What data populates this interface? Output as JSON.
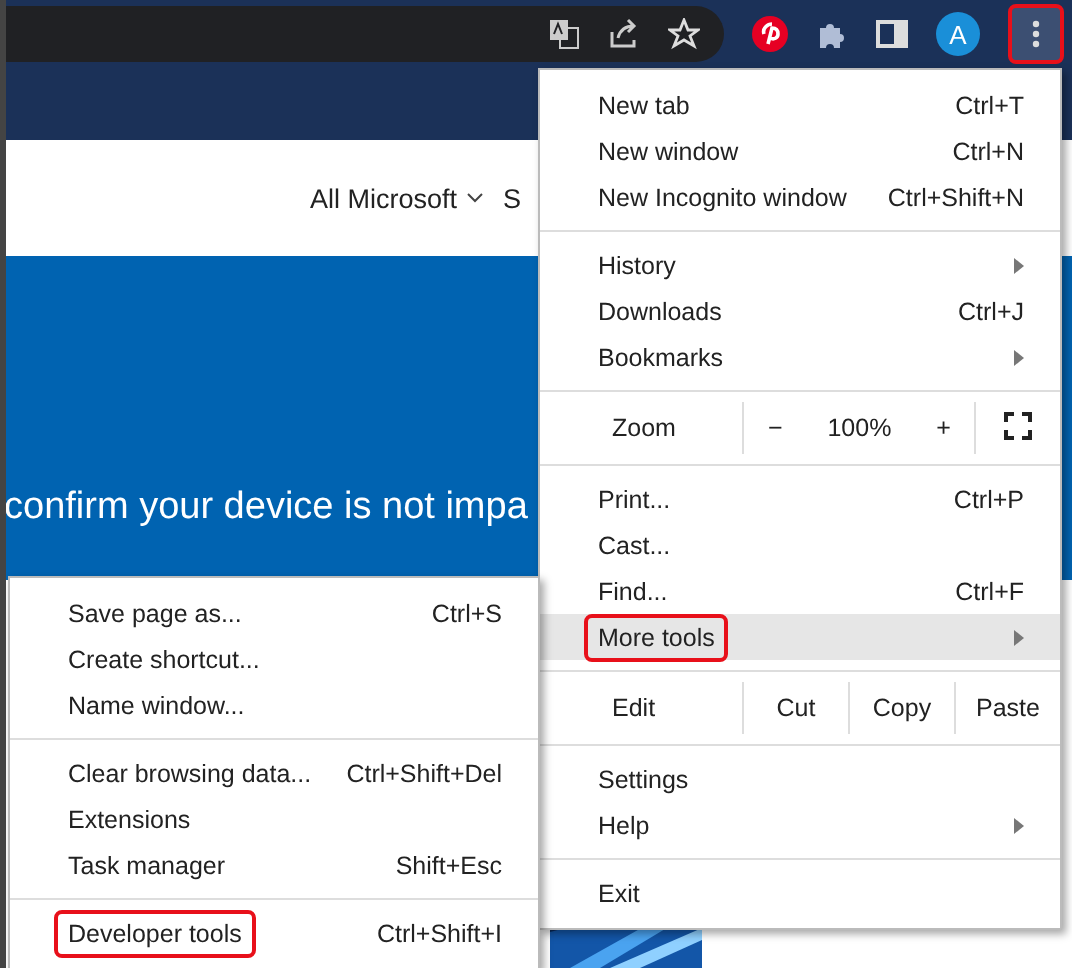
{
  "toolbar": {
    "avatar": "A",
    "menu_button": {
      "highlighted": true
    }
  },
  "page": {
    "nav_items": [
      "All Microsoft",
      "S"
    ],
    "hero_text": "confirm your device is not impa"
  },
  "menu": {
    "sections": [
      [
        {
          "kind": "item",
          "label": "New tab",
          "shortcut": "Ctrl+T",
          "submenu": false,
          "hovered": false,
          "highlighted": false
        },
        {
          "kind": "item",
          "label": "New window",
          "shortcut": "Ctrl+N",
          "submenu": false,
          "hovered": false,
          "highlighted": false
        },
        {
          "kind": "item",
          "label": "New Incognito window",
          "shortcut": "Ctrl+Shift+N",
          "submenu": false,
          "hovered": false,
          "highlighted": false
        }
      ],
      [
        {
          "kind": "item",
          "label": "History",
          "submenu": true,
          "hovered": false,
          "highlighted": false
        },
        {
          "kind": "item",
          "label": "Downloads",
          "shortcut": "Ctrl+J",
          "submenu": false,
          "hovered": false,
          "highlighted": false
        },
        {
          "kind": "item",
          "label": "Bookmarks",
          "submenu": true,
          "hovered": false,
          "highlighted": false
        }
      ],
      [
        {
          "kind": "zoom",
          "label": "Zoom",
          "minus": "−",
          "level_text": "100%",
          "plus": "+"
        }
      ],
      [
        {
          "kind": "item",
          "label": "Print...",
          "shortcut": "Ctrl+P",
          "submenu": false,
          "hovered": false,
          "highlighted": false
        },
        {
          "kind": "item",
          "label": "Cast...",
          "submenu": false,
          "hovered": false,
          "highlighted": false
        },
        {
          "kind": "item",
          "label": "Find...",
          "shortcut": "Ctrl+F",
          "submenu": false,
          "hovered": false,
          "highlighted": false
        },
        {
          "kind": "item",
          "label": "More tools",
          "submenu": true,
          "hovered": true,
          "highlighted": true
        }
      ],
      [
        {
          "kind": "edit",
          "label": "Edit",
          "actions": [
            "Cut",
            "Copy",
            "Paste"
          ]
        }
      ],
      [
        {
          "kind": "item",
          "label": "Settings",
          "submenu": false,
          "hovered": false,
          "highlighted": false
        },
        {
          "kind": "item",
          "label": "Help",
          "submenu": true,
          "hovered": false,
          "highlighted": false
        }
      ],
      [
        {
          "kind": "item",
          "label": "Exit",
          "submenu": false,
          "hovered": false,
          "highlighted": false
        }
      ]
    ]
  },
  "submenu": {
    "sections": [
      [
        {
          "kind": "item",
          "label": "Save page as...",
          "shortcut": "Ctrl+S",
          "submenu": false,
          "hovered": false,
          "highlighted": false
        },
        {
          "kind": "item",
          "label": "Create shortcut...",
          "submenu": false,
          "hovered": false,
          "highlighted": false
        },
        {
          "kind": "item",
          "label": "Name window...",
          "submenu": false,
          "hovered": false,
          "highlighted": false
        }
      ],
      [
        {
          "kind": "item",
          "label": "Clear browsing data...",
          "shortcut": "Ctrl+Shift+Del",
          "submenu": false,
          "hovered": false,
          "highlighted": false
        },
        {
          "kind": "item",
          "label": "Extensions",
          "submenu": false,
          "hovered": false,
          "highlighted": false
        },
        {
          "kind": "item",
          "label": "Task manager",
          "shortcut": "Shift+Esc",
          "submenu": false,
          "hovered": false,
          "highlighted": false
        }
      ],
      [
        {
          "kind": "item",
          "label": "Developer tools",
          "shortcut": "Ctrl+Shift+I",
          "submenu": false,
          "hovered": false,
          "highlighted": true
        }
      ]
    ]
  }
}
